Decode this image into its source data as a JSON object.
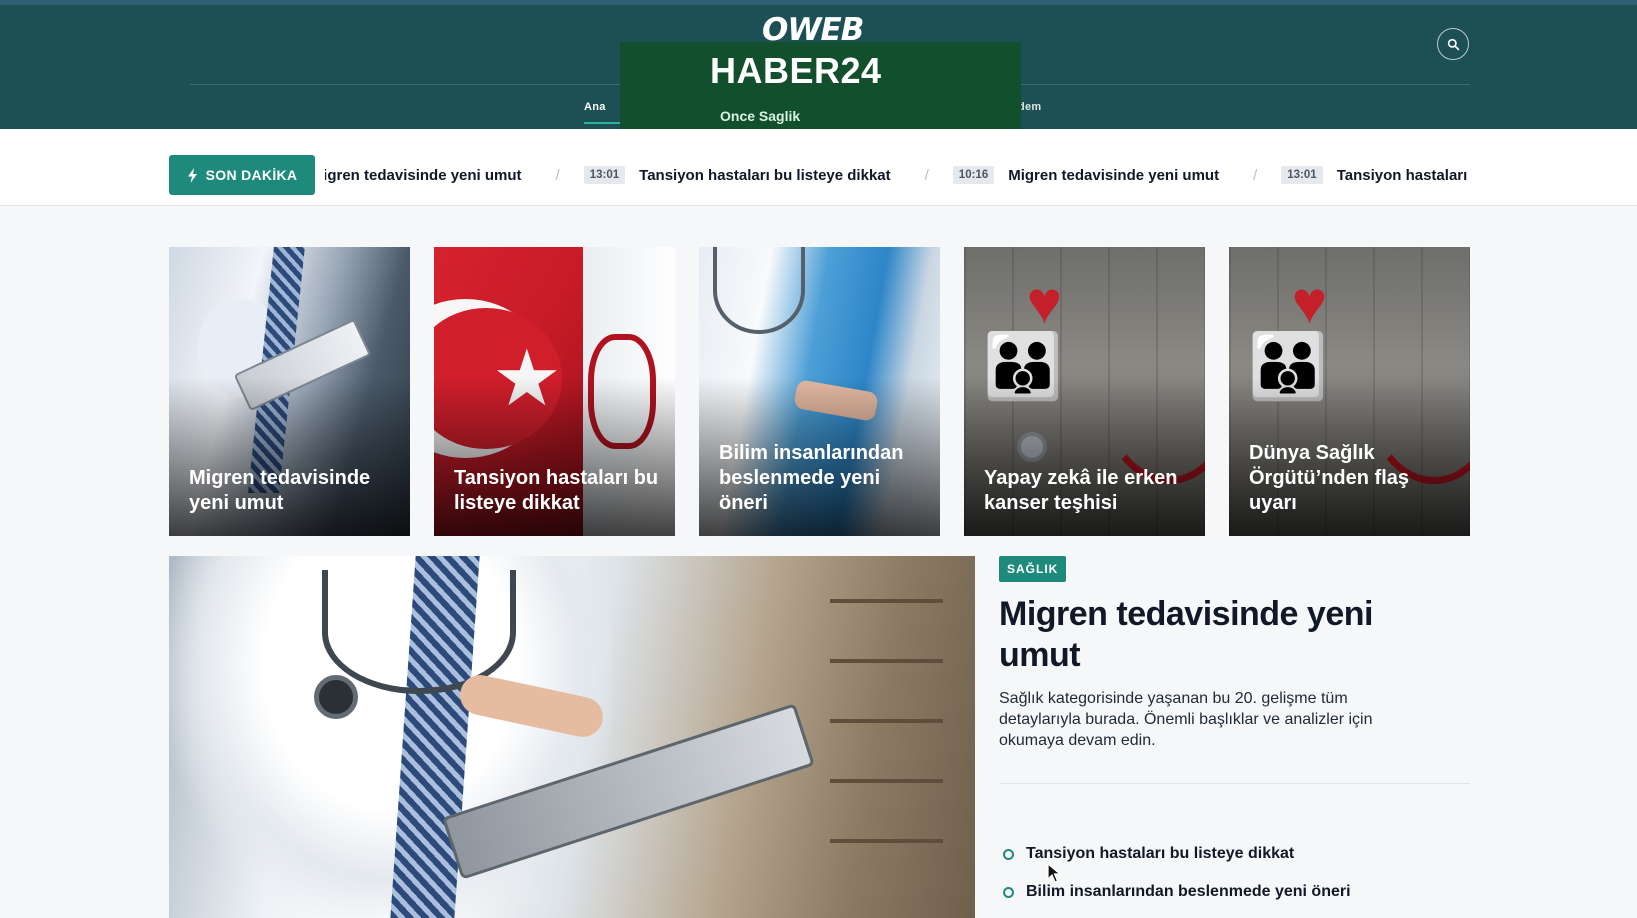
{
  "header": {
    "logo": "OWEB",
    "nav_left": "Ana",
    "nav_right": "dem",
    "search_icon": "search-icon"
  },
  "popup": {
    "title": "HABER24",
    "subtitle": "Once Saglik",
    "bg_color": "#114f2d"
  },
  "breaking": {
    "label": "SON DAKİKA",
    "icon": "bolt-icon",
    "items": [
      {
        "time": "",
        "text": "ligren tedavisinde yeni umut"
      },
      {
        "time": "13:01",
        "text": "Tansiyon hastaları bu listeye dikkat"
      },
      {
        "time": "10:16",
        "text": "Migren tedavisinde yeni umut"
      },
      {
        "time": "13:01",
        "text": "Tansiyon hastaları"
      }
    ]
  },
  "cards": [
    {
      "title": "Migren tedavisinde yeni umut"
    },
    {
      "title": "Tansiyon hastaları bu listeye dikkat"
    },
    {
      "title": "Bilim insanlarından beslenmede yeni öneri"
    },
    {
      "title": "Yapay zekâ ile erken kanser teşhisi"
    },
    {
      "title": "Dünya Sağlık Örgütü’nden flaş uyarı"
    }
  ],
  "feature": {
    "category": "SAĞLIK",
    "title": "Migren tedavisinde yeni umut",
    "description": "Sağlık kategorisinde yaşanan bu 20. gelişme tüm detaylarıyla burada. Önemli başlıklar ve analizler için okumaya devam edin.",
    "related": [
      "Tansiyon hastaları bu listeye dikkat",
      "Bilim insanlarından beslenmede yeni öneri"
    ]
  },
  "colors": {
    "header_bg": "#1c5055",
    "accent": "#1e8a7c"
  }
}
